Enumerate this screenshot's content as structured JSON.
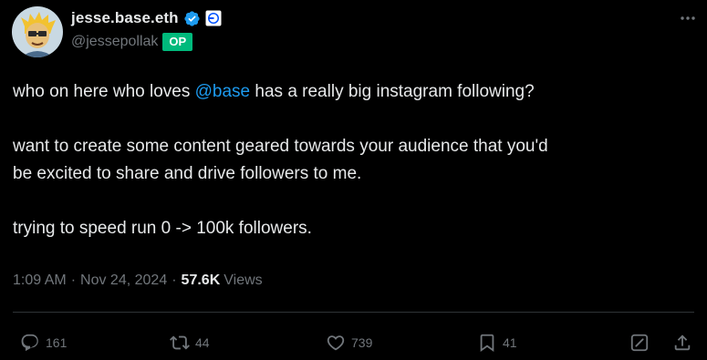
{
  "author": {
    "display_name": "jesse.base.eth",
    "handle": "@jessepollak",
    "badge": "OP",
    "verified_color": "#1d9bf0",
    "avatar_icon": "avatar"
  },
  "tweet": {
    "line1_before": "who on here who loves ",
    "mention": "@base",
    "line1_after": " has a really big instagram following?",
    "paragraph2": "want to create some content geared towards your audience that you'd\nbe excited to share and drive followers to me.",
    "paragraph3": "trying to speed run 0 -> 100k followers."
  },
  "meta": {
    "time": "1:09 AM",
    "separator": "·",
    "date": "Nov 24, 2024",
    "views_count": "57.6K",
    "views_label": "Views"
  },
  "actions": {
    "replies": "161",
    "reposts": "44",
    "likes": "739",
    "bookmarks": "41"
  },
  "colors": {
    "background": "#000000",
    "text": "#e7e9ea",
    "muted": "#71767b",
    "accent": "#1d9bf0",
    "op_badge": "#00ba7c"
  }
}
